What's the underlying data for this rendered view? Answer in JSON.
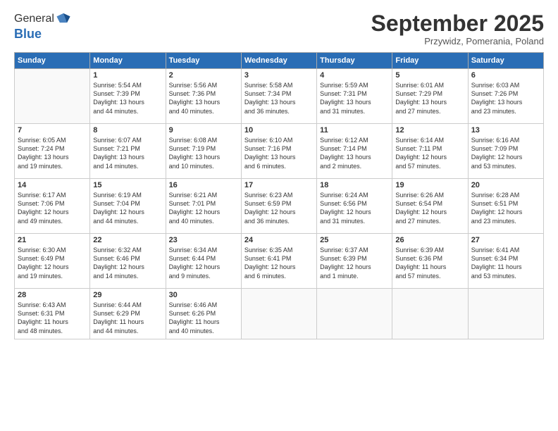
{
  "logo": {
    "line1": "General",
    "line2": "Blue"
  },
  "title": "September 2025",
  "subtitle": "Przywidz, Pomerania, Poland",
  "days_of_week": [
    "Sunday",
    "Monday",
    "Tuesday",
    "Wednesday",
    "Thursday",
    "Friday",
    "Saturday"
  ],
  "weeks": [
    [
      {
        "num": "",
        "info": ""
      },
      {
        "num": "1",
        "info": "Sunrise: 5:54 AM\nSunset: 7:39 PM\nDaylight: 13 hours\nand 44 minutes."
      },
      {
        "num": "2",
        "info": "Sunrise: 5:56 AM\nSunset: 7:36 PM\nDaylight: 13 hours\nand 40 minutes."
      },
      {
        "num": "3",
        "info": "Sunrise: 5:58 AM\nSunset: 7:34 PM\nDaylight: 13 hours\nand 36 minutes."
      },
      {
        "num": "4",
        "info": "Sunrise: 5:59 AM\nSunset: 7:31 PM\nDaylight: 13 hours\nand 31 minutes."
      },
      {
        "num": "5",
        "info": "Sunrise: 6:01 AM\nSunset: 7:29 PM\nDaylight: 13 hours\nand 27 minutes."
      },
      {
        "num": "6",
        "info": "Sunrise: 6:03 AM\nSunset: 7:26 PM\nDaylight: 13 hours\nand 23 minutes."
      }
    ],
    [
      {
        "num": "7",
        "info": "Sunrise: 6:05 AM\nSunset: 7:24 PM\nDaylight: 13 hours\nand 19 minutes."
      },
      {
        "num": "8",
        "info": "Sunrise: 6:07 AM\nSunset: 7:21 PM\nDaylight: 13 hours\nand 14 minutes."
      },
      {
        "num": "9",
        "info": "Sunrise: 6:08 AM\nSunset: 7:19 PM\nDaylight: 13 hours\nand 10 minutes."
      },
      {
        "num": "10",
        "info": "Sunrise: 6:10 AM\nSunset: 7:16 PM\nDaylight: 13 hours\nand 6 minutes."
      },
      {
        "num": "11",
        "info": "Sunrise: 6:12 AM\nSunset: 7:14 PM\nDaylight: 13 hours\nand 2 minutes."
      },
      {
        "num": "12",
        "info": "Sunrise: 6:14 AM\nSunset: 7:11 PM\nDaylight: 12 hours\nand 57 minutes."
      },
      {
        "num": "13",
        "info": "Sunrise: 6:16 AM\nSunset: 7:09 PM\nDaylight: 12 hours\nand 53 minutes."
      }
    ],
    [
      {
        "num": "14",
        "info": "Sunrise: 6:17 AM\nSunset: 7:06 PM\nDaylight: 12 hours\nand 49 minutes."
      },
      {
        "num": "15",
        "info": "Sunrise: 6:19 AM\nSunset: 7:04 PM\nDaylight: 12 hours\nand 44 minutes."
      },
      {
        "num": "16",
        "info": "Sunrise: 6:21 AM\nSunset: 7:01 PM\nDaylight: 12 hours\nand 40 minutes."
      },
      {
        "num": "17",
        "info": "Sunrise: 6:23 AM\nSunset: 6:59 PM\nDaylight: 12 hours\nand 36 minutes."
      },
      {
        "num": "18",
        "info": "Sunrise: 6:24 AM\nSunset: 6:56 PM\nDaylight: 12 hours\nand 31 minutes."
      },
      {
        "num": "19",
        "info": "Sunrise: 6:26 AM\nSunset: 6:54 PM\nDaylight: 12 hours\nand 27 minutes."
      },
      {
        "num": "20",
        "info": "Sunrise: 6:28 AM\nSunset: 6:51 PM\nDaylight: 12 hours\nand 23 minutes."
      }
    ],
    [
      {
        "num": "21",
        "info": "Sunrise: 6:30 AM\nSunset: 6:49 PM\nDaylight: 12 hours\nand 19 minutes."
      },
      {
        "num": "22",
        "info": "Sunrise: 6:32 AM\nSunset: 6:46 PM\nDaylight: 12 hours\nand 14 minutes."
      },
      {
        "num": "23",
        "info": "Sunrise: 6:34 AM\nSunset: 6:44 PM\nDaylight: 12 hours\nand 9 minutes."
      },
      {
        "num": "24",
        "info": "Sunrise: 6:35 AM\nSunset: 6:41 PM\nDaylight: 12 hours\nand 6 minutes."
      },
      {
        "num": "25",
        "info": "Sunrise: 6:37 AM\nSunset: 6:39 PM\nDaylight: 12 hours\nand 1 minute."
      },
      {
        "num": "26",
        "info": "Sunrise: 6:39 AM\nSunset: 6:36 PM\nDaylight: 11 hours\nand 57 minutes."
      },
      {
        "num": "27",
        "info": "Sunrise: 6:41 AM\nSunset: 6:34 PM\nDaylight: 11 hours\nand 53 minutes."
      }
    ],
    [
      {
        "num": "28",
        "info": "Sunrise: 6:43 AM\nSunset: 6:31 PM\nDaylight: 11 hours\nand 48 minutes."
      },
      {
        "num": "29",
        "info": "Sunrise: 6:44 AM\nSunset: 6:29 PM\nDaylight: 11 hours\nand 44 minutes."
      },
      {
        "num": "30",
        "info": "Sunrise: 6:46 AM\nSunset: 6:26 PM\nDaylight: 11 hours\nand 40 minutes."
      },
      {
        "num": "",
        "info": ""
      },
      {
        "num": "",
        "info": ""
      },
      {
        "num": "",
        "info": ""
      },
      {
        "num": "",
        "info": ""
      }
    ]
  ]
}
